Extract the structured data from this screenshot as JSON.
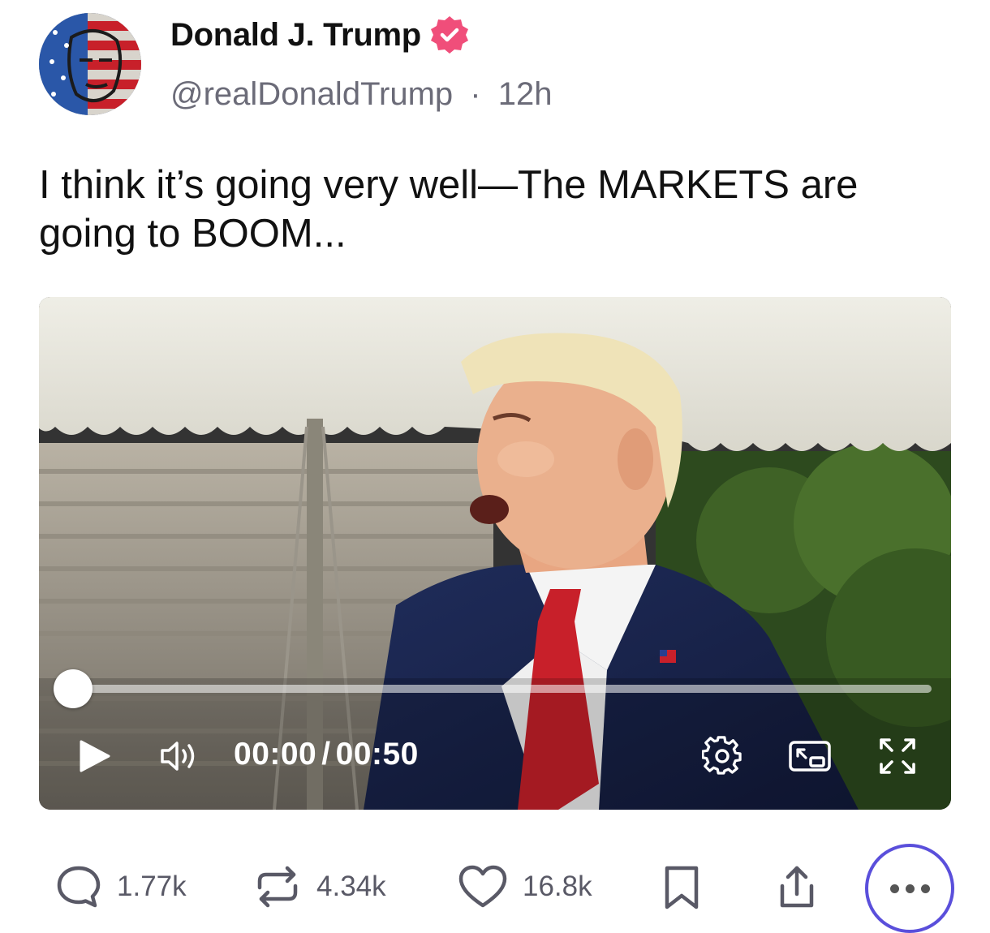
{
  "post": {
    "author_name": "Donald J. Trump",
    "handle": "@realDonaldTrump",
    "separator": "·",
    "age": "12h",
    "text": "I think it’s going very well—The MARKETS are going to BOOM..."
  },
  "video": {
    "current_time": "00:00",
    "duration": "00:50",
    "time_sep": "/",
    "progress": 0.0
  },
  "actions": {
    "replies": "1.77k",
    "reposts": "4.34k",
    "likes": "16.8k"
  },
  "colors": {
    "verified_badge": "#f04e7a",
    "more_ring": "#5a4fdb",
    "count_text": "#595966"
  },
  "icons": [
    "verified-icon",
    "play-icon",
    "volume-icon",
    "settings-icon",
    "picture-in-picture-icon",
    "fullscreen-icon",
    "reply-icon",
    "repost-icon",
    "like-icon",
    "bookmark-icon",
    "share-icon",
    "more-icon"
  ]
}
